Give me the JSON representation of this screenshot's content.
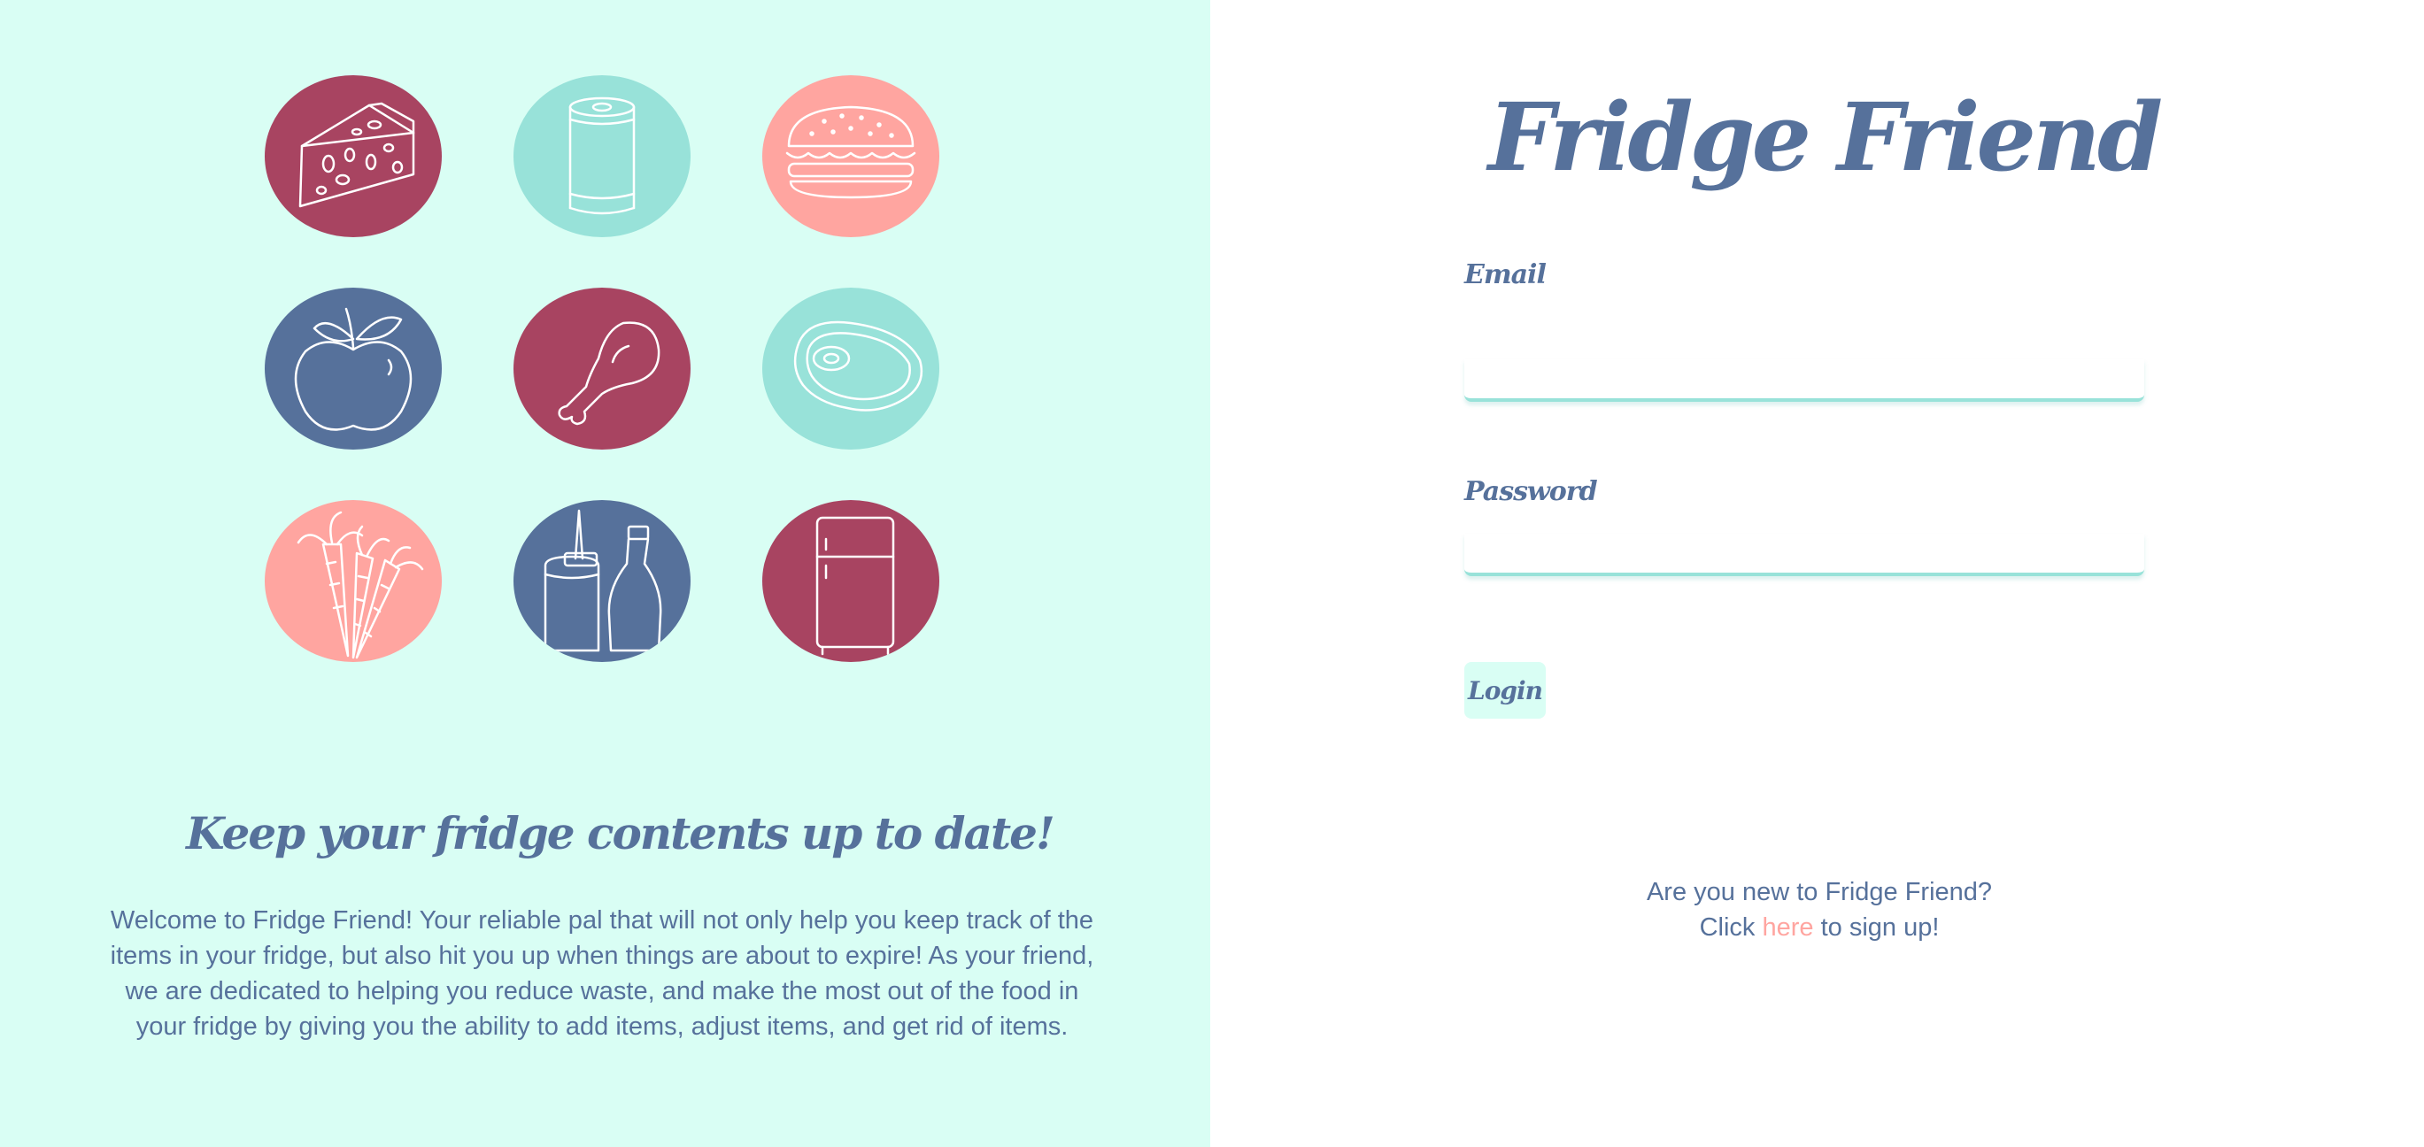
{
  "app": {
    "title": "Fridge Friend"
  },
  "colors": {
    "mint_bg": "#d9fef4",
    "navy": "#56719b",
    "maroon": "#a84461",
    "teal": "#98e2d9",
    "salmon": "#ffa5a0",
    "white": "#ffffff"
  },
  "icons": [
    {
      "name": "cheese-icon",
      "color": "#a84461"
    },
    {
      "name": "can-icon",
      "color": "#98e2d9"
    },
    {
      "name": "burger-icon",
      "color": "#ffa5a0"
    },
    {
      "name": "apple-icon",
      "color": "#56719b"
    },
    {
      "name": "drumstick-icon",
      "color": "#a84461"
    },
    {
      "name": "steak-icon",
      "color": "#98e2d9"
    },
    {
      "name": "carrots-icon",
      "color": "#ffa5a0"
    },
    {
      "name": "condiments-icon",
      "color": "#56719b"
    },
    {
      "name": "fridge-icon",
      "color": "#a84461"
    }
  ],
  "intro": {
    "heading": "Keep your fridge contents up to date!",
    "body": "Welcome to Fridge Friend! Your reliable pal that will not only help you keep track of the items in your fridge, but also hit you up when things are about to expire! As your friend, we are dedicated to helping you reduce waste, and make the most out of the food in your fridge by giving you the ability to add items, adjust items, and get rid of items."
  },
  "login_form": {
    "email_label": "Email",
    "email_value": "",
    "password_label": "Password",
    "password_value": "",
    "login_label": "Login"
  },
  "signup": {
    "question": "Are you new to Fridge Friend?",
    "prefix": "Click ",
    "link_label": "here",
    "suffix": " to sign up!"
  }
}
